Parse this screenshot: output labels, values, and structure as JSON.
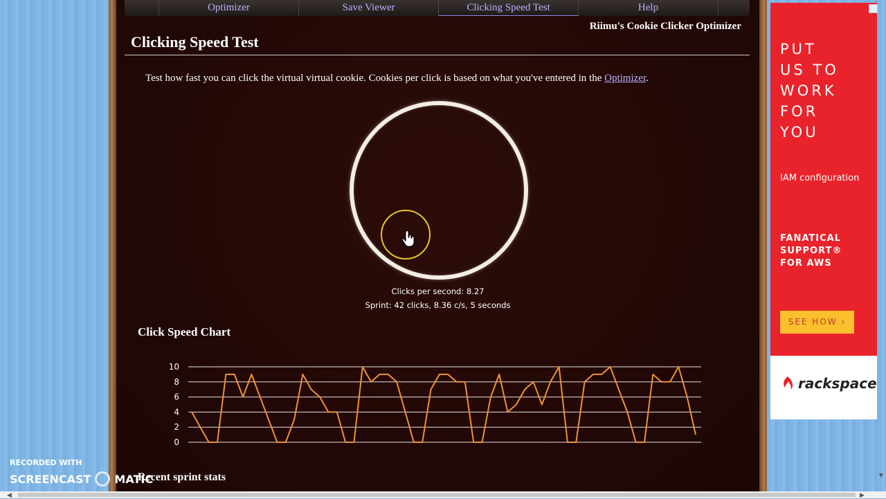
{
  "nav": {
    "items": [
      "Optimizer",
      "Save Viewer",
      "Clicking Speed Test",
      "Help"
    ],
    "active": "Clicking Speed Test"
  },
  "site_title": "Riimu's Cookie Clicker Optimizer",
  "page_title": "Clicking Speed Test",
  "intro": {
    "text": "Test how fast you can click the virtual virtual cookie. Cookies per click is based on what you've entered in the ",
    "link": "Optimizer",
    "end": "."
  },
  "stats": {
    "cps": "Clicks per second: 8.27",
    "sprint": "Sprint: 42 clicks, 8.36 c/s, 5 seconds"
  },
  "chart_title": "Click Speed Chart",
  "chart_data": {
    "type": "line",
    "ylim": [
      0,
      10
    ],
    "yticks": [
      0,
      2,
      4,
      6,
      8,
      10
    ],
    "grid": true,
    "series": [
      {
        "values": [
          4,
          2,
          0,
          0,
          9,
          9,
          6,
          9,
          6,
          3,
          0,
          0,
          3,
          9,
          7,
          6,
          4,
          4,
          0,
          0,
          10,
          8,
          9,
          9,
          8,
          4,
          0,
          0,
          7,
          9,
          9,
          8,
          8,
          0,
          0,
          6,
          9,
          4,
          5,
          7,
          8,
          5,
          8,
          10,
          0,
          0,
          8,
          9,
          9,
          10,
          7,
          4,
          0,
          0,
          9,
          8,
          8,
          10,
          6,
          1
        ]
      }
    ],
    "line_color": "#f0913a"
  },
  "recent_title": "Recent sprint stats",
  "ad": {
    "headline": [
      "PUT",
      "US TO",
      "WORK",
      "FOR",
      "YOU"
    ],
    "subline": "IAM configuration",
    "support": [
      "FANATICAL",
      "SUPPORT®",
      "FOR AWS"
    ],
    "cta": "SEE HOW",
    "brand": "rackspace"
  },
  "watermark": {
    "line1": "RECORDED WITH",
    "line2a": "SCREENCAST",
    "line2b": "MATIC"
  },
  "colors": {
    "nav_link": "#b9b2ff",
    "ad_red": "#e9232b",
    "cta_yellow": "#fbc02d",
    "cursor_ring": "#e8c52a"
  }
}
